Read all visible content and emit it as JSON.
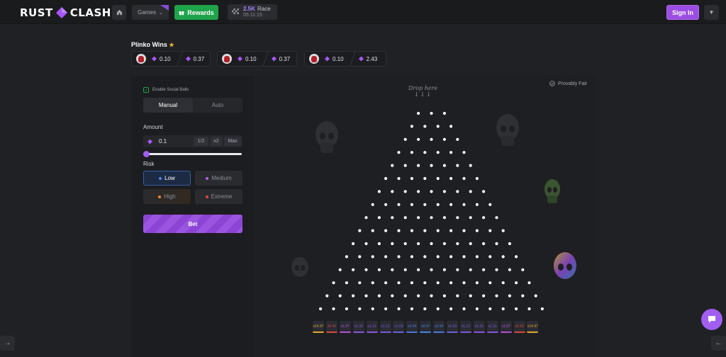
{
  "header": {
    "logo_left": "RUST",
    "logo_right": "CLASH",
    "games_label": "Games",
    "rewards_label": "Rewards",
    "race_amount": "2.5K",
    "race_label": "Race",
    "race_timer": "05:11:15",
    "signin_label": "Sign In"
  },
  "wins": {
    "title": "Plinko Wins",
    "cards": [
      {
        "bet": "0.10",
        "payout": "0.37"
      },
      {
        "bet": "0.10",
        "payout": "0.37"
      },
      {
        "bet": "0.10",
        "payout": "2.43"
      }
    ]
  },
  "controls": {
    "social_balls_label": "Enable Social Balls",
    "social_balls_checked": true,
    "tab_manual": "Manual",
    "tab_auto": "Auto",
    "amount_label": "Amount",
    "amount_value": "0.1",
    "half_label": "1/2",
    "double_label": "x2",
    "max_label": "Max",
    "risk_label": "Risk",
    "risk_low": "Low",
    "risk_medium": "Medium",
    "risk_high": "High",
    "risk_extreme": "Extreme",
    "bet_label": "Bet"
  },
  "board": {
    "provably_fair": "Provably Fair",
    "drop_here": "Drop here",
    "multipliers": [
      "x14.97",
      "x5.42",
      "x1.87",
      "x1.31",
      "x1.31",
      "x1.12",
      "x1.03",
      "x0.94",
      "x0.47",
      "x0.94",
      "x1.03",
      "x1.12",
      "x1.31",
      "x1.31",
      "x1.87",
      "x5.42",
      "x14.97"
    ]
  },
  "colors": {
    "accent": "#9b4de3",
    "rewards": "#1fa34a",
    "background": "#202124"
  }
}
